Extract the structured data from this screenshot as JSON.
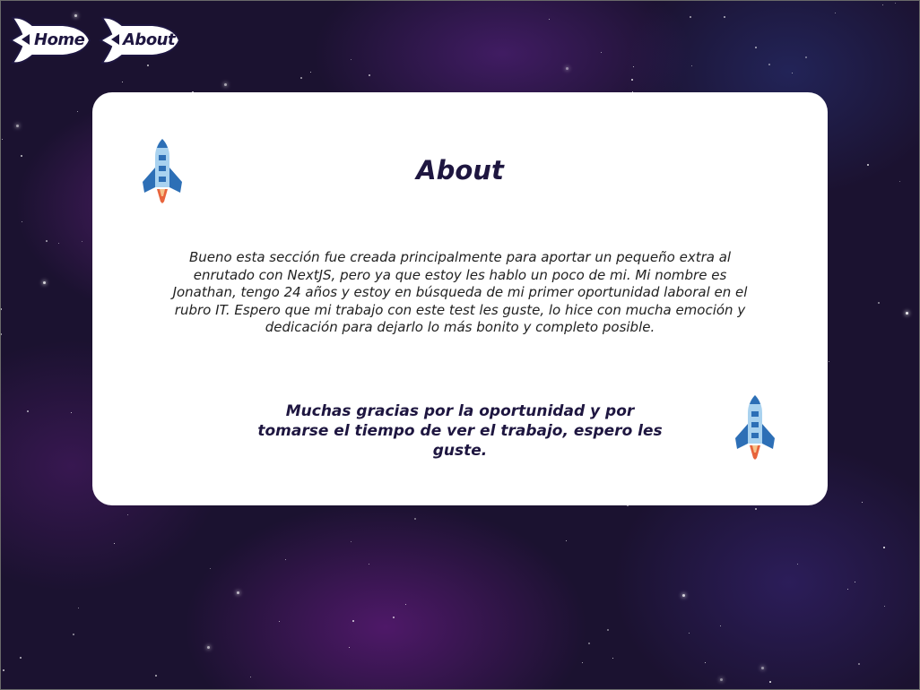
{
  "nav": {
    "home_label": "Home",
    "about_label": "About"
  },
  "card": {
    "title": "About",
    "body": "Bueno esta sección fue creada principalmente para aportar un pequeño extra al enrutado con NextJS, pero ya que estoy les hablo un poco de mi. Mi nombre es Jonathan, tengo 24 años y estoy en búsqueda de mi primer oportunidad laboral en el rubro IT. Espero que mi trabajo con este test les guste, lo hice con mucha emoción y dedicación para dejarlo lo más bonito y completo posible.",
    "thanks": "Muchas gracias por la oportunidad y por tomarse el tiempo de ver el trabajo, espero les guste."
  },
  "icons": {
    "top_rocket": "rocket-icon",
    "bottom_rocket": "rocket-icon",
    "nav_arrow": "back-arrow-icon"
  },
  "colors": {
    "background": "#1b1230",
    "card": "#ffffff",
    "text_dark": "#1e1640",
    "rocket_body": "#a9d2ef",
    "rocket_accent": "#2d6fb6",
    "rocket_flame": "#e8643c"
  }
}
